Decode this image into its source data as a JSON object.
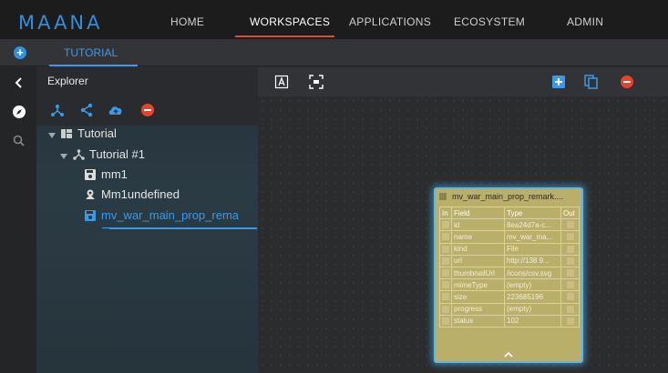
{
  "app": {
    "logo": "MAANA",
    "accent": "#2e8fdc",
    "active_nav_color": "#e04a2d"
  },
  "nav": {
    "items": [
      {
        "label": "HOME"
      },
      {
        "label": "WORKSPACES",
        "active": true
      },
      {
        "label": "APPLICATIONS"
      },
      {
        "label": "ECOSYSTEM"
      },
      {
        "label": "ADMIN"
      }
    ]
  },
  "tabs": {
    "add_icon": "plus-circle-icon",
    "items": [
      {
        "label": "TUTORIAL",
        "active": true
      }
    ]
  },
  "rail": {
    "icons": [
      "chevron-left-icon",
      "compass-icon",
      "search-icon"
    ]
  },
  "explorer": {
    "title": "Explorer",
    "tools": [
      "graph-icon",
      "share-icon",
      "upload-icon",
      "remove-icon"
    ],
    "tree": [
      {
        "label": "Tutorial",
        "icon": "dashboard-icon",
        "expanded": true
      },
      {
        "label": "Tutorial #1",
        "icon": "graph-icon",
        "expanded": true
      },
      {
        "label": "mm1",
        "icon": "save-icon"
      },
      {
        "label": "Mm1undefined",
        "icon": "service-icon"
      },
      {
        "label": "mv_war_main_prop_rema",
        "icon": "save-icon",
        "selected": true
      }
    ]
  },
  "canvas_toolbar": {
    "left_tools": [
      "text-select-icon",
      "fit-screen-icon"
    ],
    "right_tools": [
      "add-box-icon",
      "copy-icon",
      "delete-icon"
    ]
  },
  "node": {
    "title": "mv_war_main_prop_remark....",
    "headers": [
      "In",
      "Field",
      "Type",
      "Out"
    ],
    "rows": [
      {
        "field": "id",
        "type": "8ea24d7a-c..."
      },
      {
        "field": "name",
        "type": "mv_war_ma..."
      },
      {
        "field": "kind",
        "type": "File"
      },
      {
        "field": "url",
        "type": "http://138.9..."
      },
      {
        "field": "thumbnailUrl",
        "type": "/icons/csv.svg"
      },
      {
        "field": "mimeType",
        "type": "(empty)"
      },
      {
        "field": "size",
        "type": "223685196"
      },
      {
        "field": "progress",
        "type": "(empty)"
      },
      {
        "field": "status",
        "type": "102"
      }
    ],
    "colors": {
      "body": "#b9ae6a",
      "border": "#58b8f0"
    }
  }
}
